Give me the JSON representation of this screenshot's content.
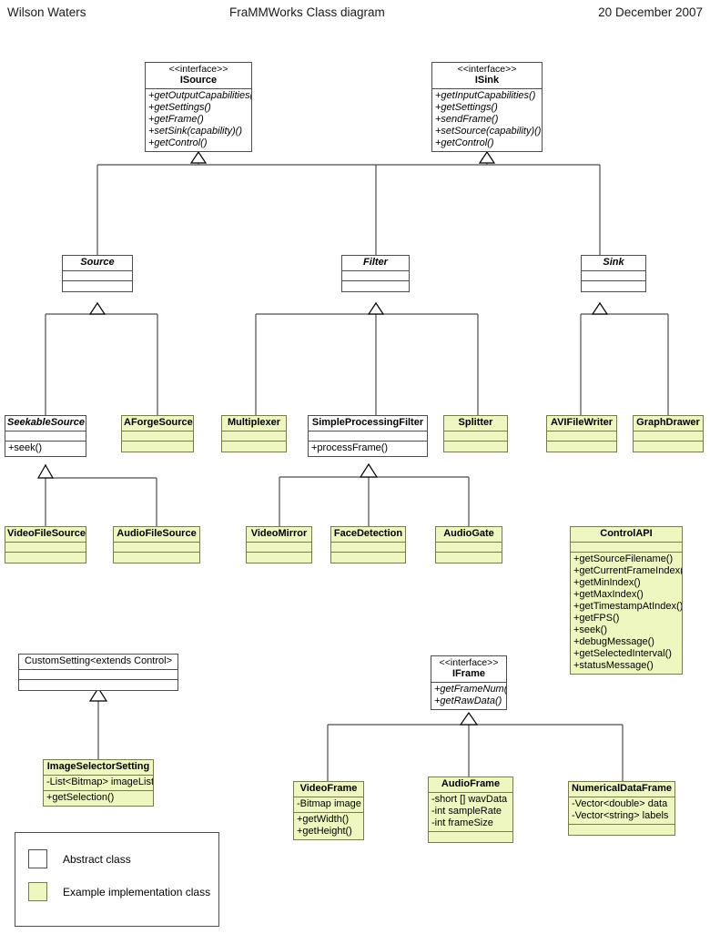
{
  "header": {
    "author": "Wilson Waters",
    "title": "FraMMWorks Class diagram",
    "date": "20 December 2007"
  },
  "colors": {
    "abstract_fill": "#ffffff",
    "implementation_fill": "#edf7bf",
    "border": "#4d4d4d",
    "implementation_border": "#7a7a4a",
    "connector": "#4d4d4d"
  },
  "legend": {
    "items": [
      {
        "swatch": "white",
        "label": "Abstract class"
      },
      {
        "swatch": "yellow",
        "label": "Example implementation class"
      }
    ]
  },
  "classes": {
    "isource": {
      "stereotype": "<<interface>>",
      "name": "ISource",
      "members": [
        "+getOutputCapabilities()",
        "+getSettings()",
        "+getFrame()",
        "+setSink(capability)()",
        "+getControl()"
      ]
    },
    "isink": {
      "stereotype": "<<interface>>",
      "name": "ISink",
      "members": [
        "+getInputCapabilities()",
        "+getSettings()",
        "+sendFrame()",
        "+setSource(capability)()",
        "+getControl()"
      ]
    },
    "source": {
      "name": "Source",
      "attributes": [],
      "methods": []
    },
    "filter": {
      "name": "Filter",
      "attributes": [],
      "methods": []
    },
    "sink": {
      "name": "Sink",
      "attributes": [],
      "methods": []
    },
    "seekablesource": {
      "name": "SeekableSource",
      "attributes": [],
      "methods": [
        "+seek()"
      ]
    },
    "aforgesource": {
      "name": "AForgeSource",
      "attributes": [],
      "methods": []
    },
    "multiplexer": {
      "name": "Multiplexer",
      "attributes": [],
      "methods": []
    },
    "simpleprocessingfilter": {
      "name": "SimpleProcessingFilter",
      "attributes": [],
      "methods": [
        "+processFrame()"
      ]
    },
    "splitter": {
      "name": "Splitter",
      "attributes": [],
      "methods": []
    },
    "avifilewriter": {
      "name": "AVIFileWriter",
      "attributes": [],
      "methods": []
    },
    "graphdrawer": {
      "name": "GraphDrawer",
      "attributes": [],
      "methods": []
    },
    "videofilesource": {
      "name": "VideoFileSource",
      "attributes": [],
      "methods": []
    },
    "audiofilesource": {
      "name": "AudioFileSource",
      "attributes": [],
      "methods": []
    },
    "videomirror": {
      "name": "VideoMirror",
      "attributes": [],
      "methods": []
    },
    "facedetection": {
      "name": "FaceDetection",
      "attributes": [],
      "methods": []
    },
    "audiogate": {
      "name": "AudioGate",
      "attributes": [],
      "methods": []
    },
    "controlapi": {
      "name": "ControlAPI",
      "attributes": [],
      "methods": [
        "+getSourceFilename()",
        "+getCurrentFrameIndex()",
        "+getMinIndex()",
        "+getMaxIndex()",
        "+getTimestampAtIndex()",
        "+getFPS()",
        "+seek()",
        "+debugMessage()",
        "+getSelectedInterval()",
        "+statusMessage()"
      ]
    },
    "customsetting": {
      "name": "CustomSetting<extends Control>",
      "attributes": [],
      "methods": []
    },
    "imageselectorsetting": {
      "name": "ImageSelectorSetting",
      "attributes": [
        "-List<Bitmap> imageList"
      ],
      "methods": [
        "+getSelection()"
      ]
    },
    "iframe": {
      "stereotype": "<<interface>>",
      "name": "IFrame",
      "members": [
        "+getFrameNum()",
        "+getRawData()"
      ]
    },
    "videoframe": {
      "name": "VideoFrame",
      "attributes": [
        "-Bitmap image"
      ],
      "methods": [
        "+getWidth()",
        "+getHeight()"
      ]
    },
    "audioframe": {
      "name": "AudioFrame",
      "attributes": [
        "-short [] wavData",
        "-int sampleRate",
        "-int frameSize"
      ],
      "methods": []
    },
    "numericaldataframe": {
      "name": "NumericalDataFrame",
      "attributes": [
        "-Vector<double> data",
        "-Vector<string> labels"
      ],
      "methods": []
    }
  },
  "relations": [
    {
      "type": "generalization",
      "from": "Source",
      "to": "ISource"
    },
    {
      "type": "generalization",
      "from": "Filter",
      "to": "ISource"
    },
    {
      "type": "generalization",
      "from": "Filter",
      "to": "ISink"
    },
    {
      "type": "generalization",
      "from": "Sink",
      "to": "ISink"
    },
    {
      "type": "generalization",
      "from": "SeekableSource",
      "to": "Source"
    },
    {
      "type": "generalization",
      "from": "AForgeSource",
      "to": "Source"
    },
    {
      "type": "generalization",
      "from": "Multiplexer",
      "to": "Filter"
    },
    {
      "type": "generalization",
      "from": "SimpleProcessingFilter",
      "to": "Filter"
    },
    {
      "type": "generalization",
      "from": "Splitter",
      "to": "Filter"
    },
    {
      "type": "generalization",
      "from": "AVIFileWriter",
      "to": "Sink"
    },
    {
      "type": "generalization",
      "from": "GraphDrawer",
      "to": "Sink"
    },
    {
      "type": "generalization",
      "from": "VideoFileSource",
      "to": "SeekableSource"
    },
    {
      "type": "generalization",
      "from": "AudioFileSource",
      "to": "SeekableSource"
    },
    {
      "type": "generalization",
      "from": "VideoMirror",
      "to": "SimpleProcessingFilter"
    },
    {
      "type": "generalization",
      "from": "FaceDetection",
      "to": "SimpleProcessingFilter"
    },
    {
      "type": "generalization",
      "from": "AudioGate",
      "to": "SimpleProcessingFilter"
    },
    {
      "type": "generalization",
      "from": "ImageSelectorSetting",
      "to": "CustomSetting<extends Control>"
    },
    {
      "type": "generalization",
      "from": "VideoFrame",
      "to": "IFrame"
    },
    {
      "type": "generalization",
      "from": "AudioFrame",
      "to": "IFrame"
    },
    {
      "type": "generalization",
      "from": "NumericalDataFrame",
      "to": "IFrame"
    }
  ]
}
